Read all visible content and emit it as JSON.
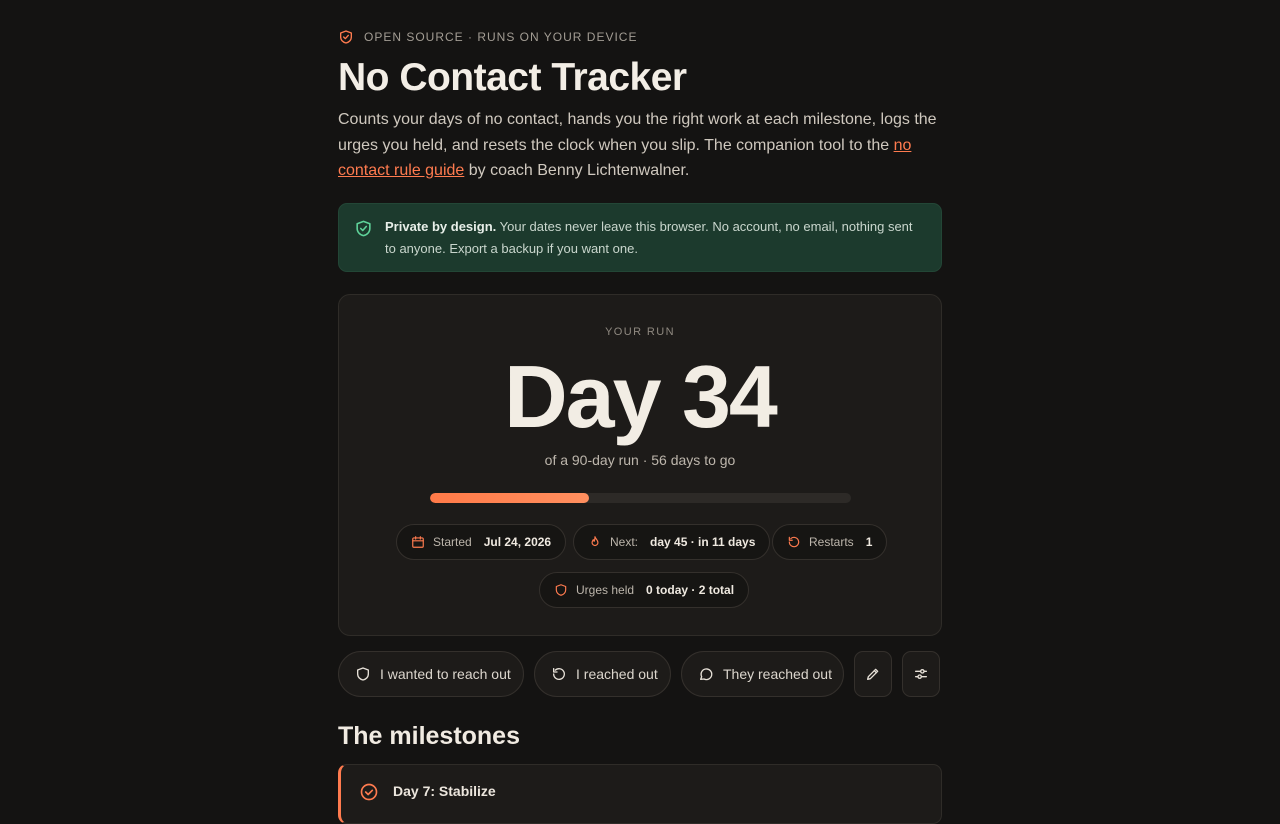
{
  "header": {
    "eyebrow": "OPEN SOURCE · RUNS ON YOUR DEVICE",
    "title": "No Contact Tracker",
    "intro_before_link": "Counts your days of no contact, hands you the right work at each milestone, logs the urges you held, and resets the clock when you slip. The companion tool to the ",
    "intro_link": "no contact rule guide",
    "intro_after_link": " by coach Benny Lichtenwalner."
  },
  "privacy": {
    "bold": "Private by design.",
    "text": " Your dates never leave this browser. No account, no email, nothing sent to anyone. Export a backup if you want one."
  },
  "run": {
    "label": "YOUR RUN",
    "day": "Day 34",
    "subtitle": "of a 90-day run · 56 days to go",
    "progress": 0.378,
    "chips": {
      "started_label": "Started",
      "started_value": "Jul 24, 2026",
      "next_label": "Next:",
      "next_value": "day 45 · in 11 days",
      "restarts_label": "Restarts",
      "restarts_value": "1",
      "urges_label": "Urges held",
      "urges_value": "0 today · 2 total"
    }
  },
  "actions": {
    "wanted": "I wanted to reach out",
    "reached": "I reached out",
    "they": "They reached out",
    "edit_icon": "pencil-icon",
    "settings_icon": "sliders-icon"
  },
  "milestones": {
    "heading": "The milestones",
    "items": [
      {
        "label": "Day 7: Stabilize"
      }
    ]
  },
  "colors": {
    "accent": "#ff7b4f",
    "background": "#141312",
    "privacy_bg": "#1c3a2d",
    "privacy_icon": "#5fd39a"
  }
}
